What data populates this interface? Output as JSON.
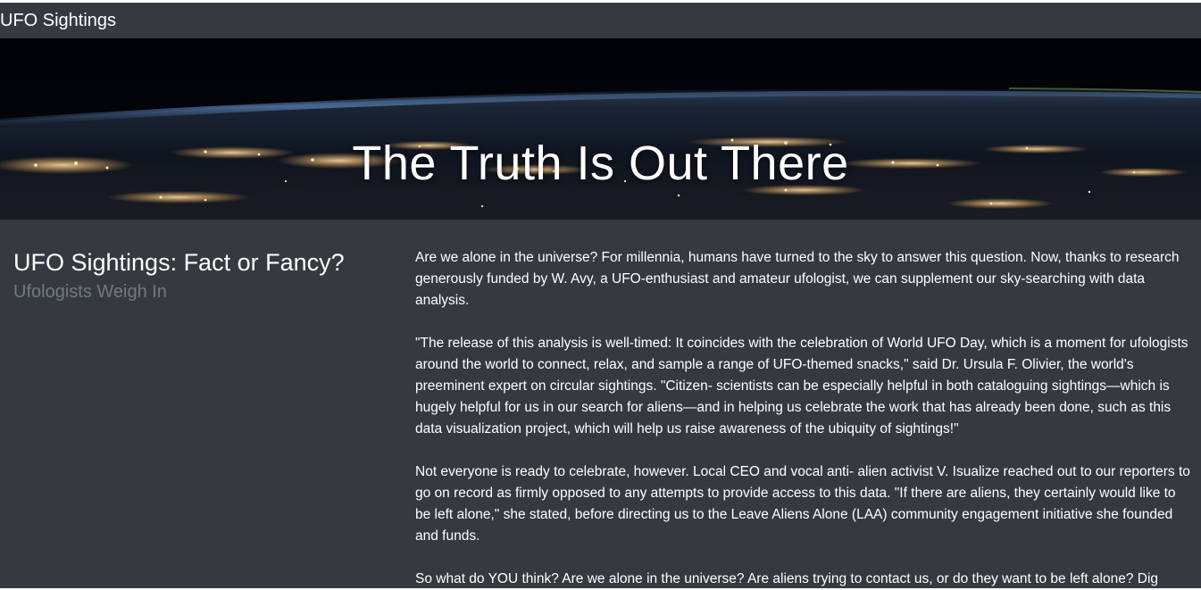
{
  "navbar": {
    "brand": "UFO Sightings"
  },
  "hero": {
    "title": "The Truth Is Out There",
    "image": "earth-at-night-from-orbit"
  },
  "sidebar": {
    "heading": "UFO Sightings: Fact or Fancy?",
    "subheading": "Ufologists Weigh In"
  },
  "article": {
    "paragraphs": [
      "Are we alone in the universe? For millennia, humans have turned to the sky to answer this question. Now, thanks to research generously funded by W. Avy, a UFO-enthusiast and amateur ufologist, we can supplement our sky-searching with data analysis.",
      "\"The release of this analysis is well-timed: It coincides with the celebration of World UFO Day, which is a moment for ufologists around the world to connect, relax, and sample a range of UFO-themed snacks,\" said Dr. Ursula F. Olivier, the world's preeminent expert on circular sightings. \"Citizen- scientists can be especially helpful in both cataloguing sightings—which is hugely helpful for us in our search for aliens—and in helping us celebrate the work that has already been done, such as this data visualization project, which will help us raise awareness of the ubiquity of sightings!\"",
      "Not everyone is ready to celebrate, however. Local CEO and vocal anti- alien activist V. Isualize reached out to our reporters to go on record as firmly opposed to any attempts to provide access to this data. \"If there are aliens, they certainly would like to be left alone,\" she stated, before directing us to the Leave Aliens Alone (LAA) community engagement initiative she founded and funds.",
      "So what do YOU think? Are we alone in the universe? Are aliens trying to contact us, or do they want to be left alone? Dig"
    ]
  },
  "colors": {
    "page_background": "#343a40",
    "text": "#ffffff",
    "subheading": "#737980"
  }
}
